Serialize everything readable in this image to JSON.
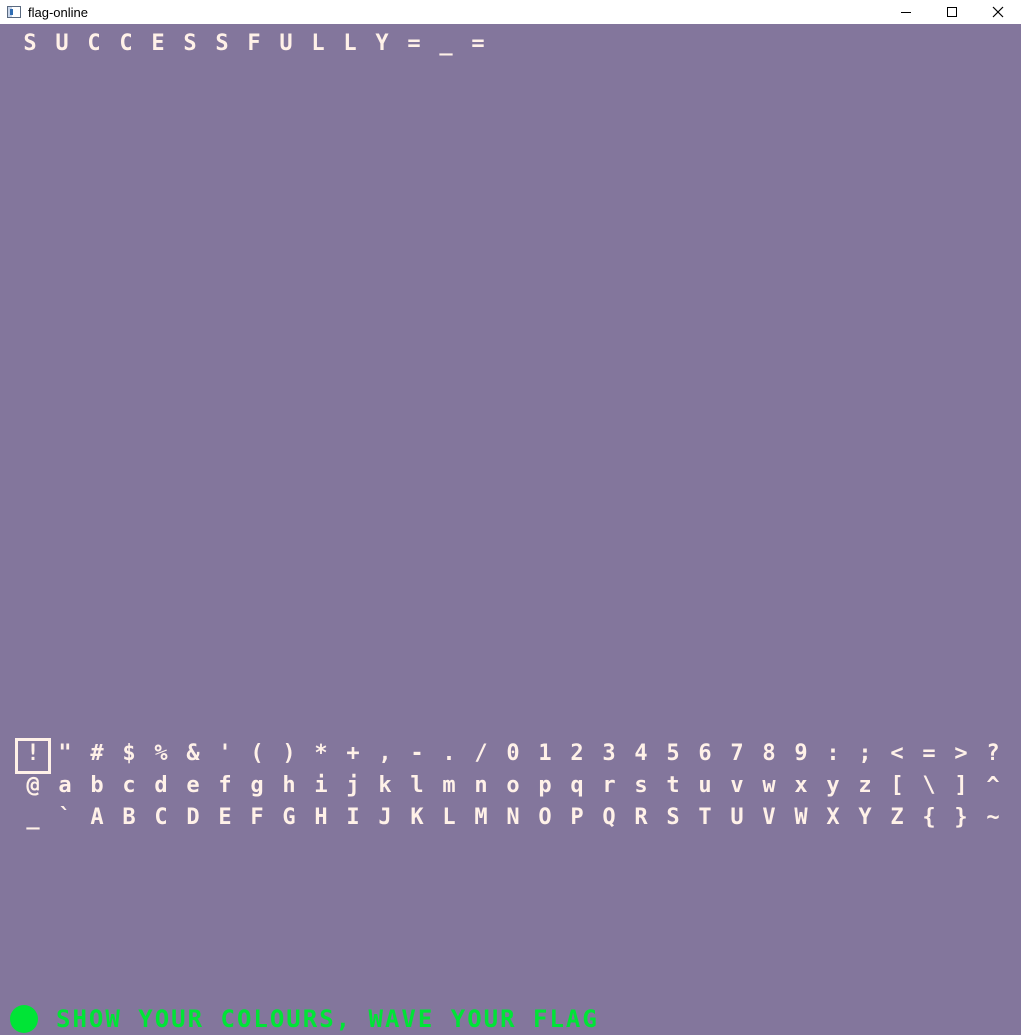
{
  "window": {
    "title": "flag-online",
    "minimize_icon": "minimize-icon",
    "maximize_icon": "maximize-icon",
    "close_icon": "close-icon"
  },
  "colors": {
    "background": "#83769c",
    "text": "#fff1e8",
    "accent": "#00e436"
  },
  "result": {
    "chars": [
      "S",
      "U",
      "C",
      "C",
      "E",
      "S",
      "S",
      "F",
      "U",
      "L",
      "L",
      "Y",
      "=",
      "_",
      "="
    ]
  },
  "keyboard": {
    "selected": "!",
    "rows": [
      [
        "!",
        "\"",
        "#",
        "$",
        "%",
        "&",
        "'",
        "(",
        ")",
        "*",
        "+",
        ",",
        "-",
        ".",
        "/",
        "0",
        "1",
        "2",
        "3",
        "4",
        "5",
        "6",
        "7",
        "8",
        "9",
        ":",
        ";",
        "<",
        "=",
        ">",
        "?"
      ],
      [
        "@",
        "a",
        "b",
        "c",
        "d",
        "e",
        "f",
        "g",
        "h",
        "i",
        "j",
        "k",
        "l",
        "m",
        "n",
        "o",
        "p",
        "q",
        "r",
        "s",
        "t",
        "u",
        "v",
        "w",
        "x",
        "y",
        "z",
        "[",
        "\\",
        "]",
        "^"
      ],
      [
        "_",
        "`",
        "A",
        "B",
        "C",
        "D",
        "E",
        "F",
        "G",
        "H",
        "I",
        "J",
        "K",
        "L",
        "M",
        "N",
        "O",
        "P",
        "Q",
        "R",
        "S",
        "T",
        "U",
        "V",
        "W",
        "X",
        "Y",
        "Z",
        "{",
        "}",
        "~"
      ]
    ]
  },
  "status": {
    "icon": "flag-dot-icon",
    "text": "Show your colours, wave your flag"
  }
}
